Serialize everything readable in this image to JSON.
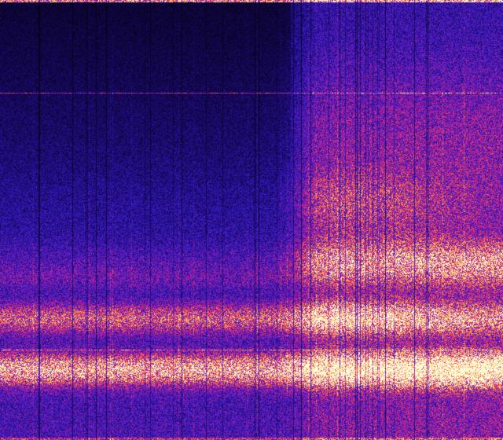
{
  "image": {
    "kind": "spectrogram",
    "colormap": [
      "#000000",
      "#1a0a6e",
      "#3a1bc8",
      "#8a1fb0",
      "#e0257a",
      "#ff7a3a",
      "#ffd66b",
      "#ffffe0"
    ],
    "background_color": "#05001a",
    "regions": [
      {
        "name": "dark-upper-left-quiet-area",
        "intensity": 0.05
      },
      {
        "name": "bright-bottom-band",
        "intensity": 0.95
      },
      {
        "name": "middle-band",
        "intensity": 0.55
      },
      {
        "name": "upper-middle-band",
        "intensity": 0.4
      },
      {
        "name": "onset-right-activity",
        "intensity": 0.6
      }
    ]
  }
}
